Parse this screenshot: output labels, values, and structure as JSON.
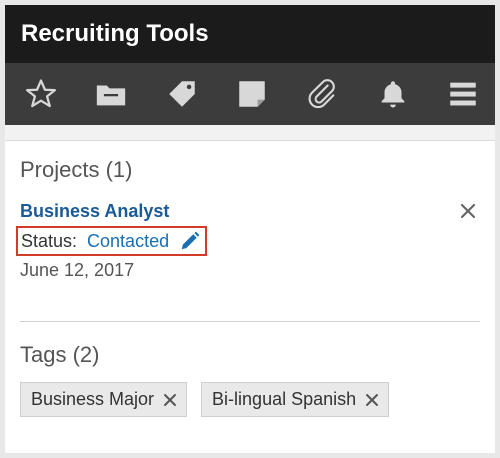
{
  "app": {
    "title": "Recruiting Tools"
  },
  "toolbar": {
    "icons": [
      "star-icon",
      "folder-icon",
      "tag-icon",
      "note-icon",
      "paperclip-icon",
      "bell-icon",
      "menu-icon"
    ]
  },
  "projects": {
    "heading": "Projects (1)",
    "items": [
      {
        "title": "Business Analyst",
        "status_label": "Status:",
        "status_value": "Contacted",
        "date": "June 12, 2017"
      }
    ]
  },
  "tags": {
    "heading": "Tags (2)",
    "items": [
      {
        "label": "Business Major"
      },
      {
        "label": "Bi-lingual Spanish"
      }
    ]
  },
  "colors": {
    "titlebar": "#1b1b1b",
    "toolbar": "#3c3c3c",
    "link": "#1a5a96",
    "status_link": "#1a6fb0",
    "highlight_border": "#d23b2a"
  }
}
